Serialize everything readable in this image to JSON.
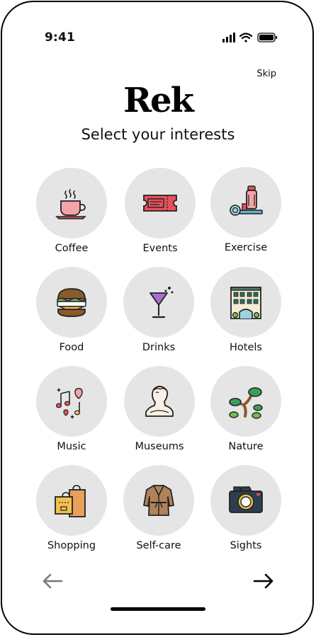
{
  "status_bar": {
    "time": "9:41"
  },
  "header": {
    "skip_label": "Skip",
    "logo_text": "Rek",
    "subtitle": "Select your interests"
  },
  "interests": [
    {
      "label": "Coffee",
      "icon": "coffee-cup-icon"
    },
    {
      "label": "Events",
      "icon": "ticket-icon"
    },
    {
      "label": "Exercise",
      "icon": "exercise-equipment-icon"
    },
    {
      "label": "Food",
      "icon": "burger-icon"
    },
    {
      "label": "Drinks",
      "icon": "cocktail-icon"
    },
    {
      "label": "Hotels",
      "icon": "hotel-building-icon"
    },
    {
      "label": "Music",
      "icon": "music-notes-icon"
    },
    {
      "label": "Museums",
      "icon": "bust-statue-icon"
    },
    {
      "label": "Nature",
      "icon": "bonsai-tree-icon"
    },
    {
      "label": "Shopping",
      "icon": "shopping-bags-icon"
    },
    {
      "label": "Self-care",
      "icon": "bathrobe-icon"
    },
    {
      "label": "Sights",
      "icon": "camera-icon"
    }
  ],
  "navigation": {
    "back_icon": "arrow-left-icon",
    "next_icon": "arrow-right-icon"
  },
  "colors": {
    "circle_bg": "#e5e5e5",
    "back_arrow": "#777777",
    "next_arrow": "#000000"
  }
}
